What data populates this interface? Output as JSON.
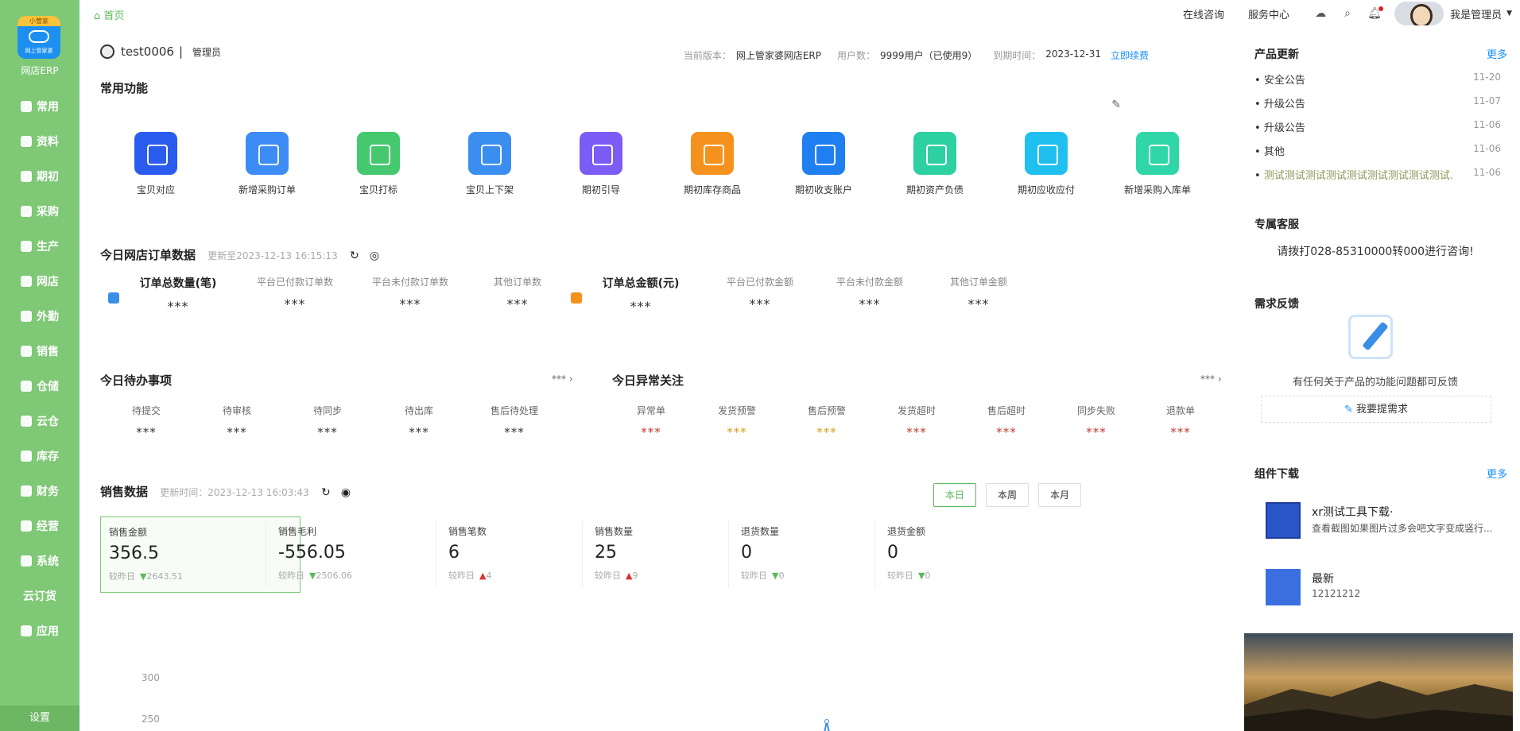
{
  "sidebar": {
    "logo_ribbon": "小管家",
    "logo_sub": "网上管家婆",
    "logo_label": "网店ERP",
    "items": [
      {
        "label": "常用",
        "icon": "star-icon"
      },
      {
        "label": "资料",
        "icon": "file-icon"
      },
      {
        "label": "期初",
        "icon": "clock-icon"
      },
      {
        "label": "采购",
        "icon": "cart-icon"
      },
      {
        "label": "生产",
        "icon": "factory-icon"
      },
      {
        "label": "网店",
        "icon": "shop-icon"
      },
      {
        "label": "外勤",
        "icon": "location-icon"
      },
      {
        "label": "销售",
        "icon": "sales-icon"
      },
      {
        "label": "仓储",
        "icon": "box-icon"
      },
      {
        "label": "云仓",
        "icon": "cloud-icon"
      },
      {
        "label": "库存",
        "icon": "warehouse-icon"
      },
      {
        "label": "财务",
        "icon": "money-icon"
      },
      {
        "label": "经营",
        "icon": "chart-icon"
      },
      {
        "label": "系统",
        "icon": "gear-icon"
      },
      {
        "label": "云订货",
        "icon": ""
      },
      {
        "label": "应用",
        "icon": "plus-icon"
      }
    ],
    "settings": "设置"
  },
  "topbar": {
    "home": "首页",
    "consult": "在线咨询",
    "service": "服务中心",
    "user": "我是管理员"
  },
  "user": {
    "name": "test0006",
    "role": "管理员",
    "version_label": "当前版本：",
    "version": "网上管家婆网店ERP",
    "users_label": "用户数：",
    "users": "9999用户（已使用9）",
    "expire_label": "到期时间：",
    "expire": "2023-12-31",
    "renew": "立即续费"
  },
  "common": {
    "title": "常用功能",
    "items": [
      {
        "label": "宝贝对应",
        "color": "#2b5cf0"
      },
      {
        "label": "新增采购订单",
        "color": "#3d8cf5"
      },
      {
        "label": "宝贝打标",
        "color": "#45c86e"
      },
      {
        "label": "宝贝上下架",
        "color": "#3a8ef0"
      },
      {
        "label": "期初引导",
        "color": "#7b5cf5"
      },
      {
        "label": "期初库存商品",
        "color": "#f5921e"
      },
      {
        "label": "期初收支账户",
        "color": "#1f7ef0"
      },
      {
        "label": "期初资产负债",
        "color": "#2dd0a0"
      },
      {
        "label": "期初应收应付",
        "color": "#1fc0f0"
      },
      {
        "label": "新增采购入库单",
        "color": "#2ed6a8"
      }
    ]
  },
  "orders": {
    "title": "今日网店订单数据",
    "updated": "更新至2023-12-13 16:15:13",
    "cells": [
      {
        "label": "订单总数量(笔)",
        "value": "***"
      },
      {
        "label": "平台已付款订单数",
        "value": "***"
      },
      {
        "label": "平台未付款订单数",
        "value": "***"
      },
      {
        "label": "其他订单数",
        "value": "***"
      },
      {
        "label": "订单总金额(元)",
        "value": "***"
      },
      {
        "label": "平台已付款金额",
        "value": "***"
      },
      {
        "label": "平台未付款金额",
        "value": "***"
      },
      {
        "label": "其他订单金额",
        "value": "***"
      }
    ]
  },
  "todo": {
    "title": "今日待办事项",
    "more": "***",
    "cells": [
      {
        "label": "待提交",
        "value": "***"
      },
      {
        "label": "待审核",
        "value": "***"
      },
      {
        "label": "待同步",
        "value": "***"
      },
      {
        "label": "待出库",
        "value": "***"
      },
      {
        "label": "售后待处理",
        "value": "***"
      }
    ]
  },
  "abnormal": {
    "title": "今日异常关注",
    "more": "***",
    "cells": [
      {
        "label": "异常单",
        "value": "***",
        "color": "#c0392b"
      },
      {
        "label": "发货预警",
        "value": "***",
        "color": "#d4a017"
      },
      {
        "label": "售后预警",
        "value": "***",
        "color": "#d4a017"
      },
      {
        "label": "发货超时",
        "value": "***",
        "color": "#c0392b"
      },
      {
        "label": "售后超时",
        "value": "***",
        "color": "#c0392b"
      },
      {
        "label": "同步失败",
        "value": "***",
        "color": "#c0392b"
      },
      {
        "label": "退款单",
        "value": "***",
        "color": "#c0392b"
      }
    ]
  },
  "sales": {
    "title": "销售数据",
    "updated": "更新时间：2023-12-13 16:03:43",
    "ranges": [
      "本日",
      "本周",
      "本月"
    ],
    "cards": [
      {
        "label": "销售金额",
        "value": "356.5",
        "cmp_label": "较昨日",
        "cmp": "2643.51",
        "dir": "down"
      },
      {
        "label": "销售毛利",
        "value": "-556.05",
        "cmp_label": "较昨日",
        "cmp": "2506.06",
        "dir": "down"
      },
      {
        "label": "销售笔数",
        "value": "6",
        "cmp_label": "较昨日",
        "cmp": "4",
        "dir": "up"
      },
      {
        "label": "销售数量",
        "value": "25",
        "cmp_label": "较昨日",
        "cmp": "9",
        "dir": "up"
      },
      {
        "label": "退货数量",
        "value": "0",
        "cmp_label": "较昨日",
        "cmp": "0",
        "dir": "down"
      },
      {
        "label": "退货金额",
        "value": "0",
        "cmp_label": "较昨日",
        "cmp": "0",
        "dir": "down"
      }
    ],
    "y_ticks": [
      "300",
      "250"
    ]
  },
  "right": {
    "updates_title": "产品更新",
    "more": "更多",
    "news": [
      {
        "title": "安全公告",
        "date": "11-20"
      },
      {
        "title": "升级公告",
        "date": "11-07"
      },
      {
        "title": "升级公告",
        "date": "11-06"
      },
      {
        "title": "其他",
        "date": "11-06"
      },
      {
        "title": "测试测试测试测试测试测试测试测试测试...",
        "date": "11-06"
      }
    ],
    "service_title": "专属客服",
    "service_text": "请拨打028-85310000转000进行咨询!",
    "feedback_title": "需求反馈",
    "feedback_text": "有任何关于产品的功能问题都可反馈",
    "feedback_btn": "我要提需求",
    "download_title": "组件下载",
    "download_more": "更多",
    "components": [
      {
        "name": "xr测试工具下载·",
        "desc": "查看截图如果图片过多会吧文字变成竖行..."
      },
      {
        "name": "最新",
        "desc": "12121212"
      }
    ]
  }
}
